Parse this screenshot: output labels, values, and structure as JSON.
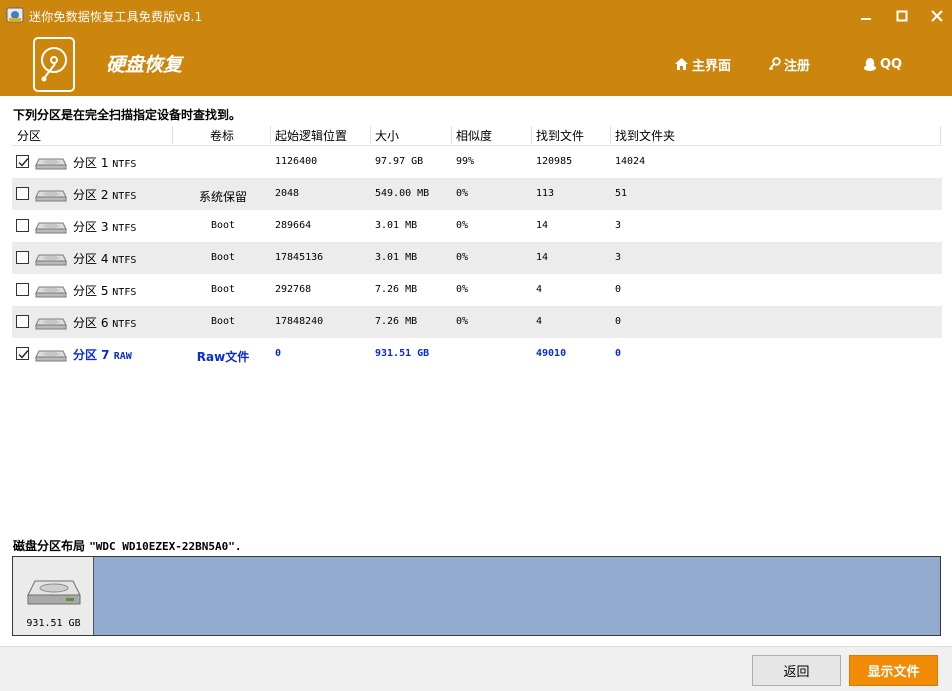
{
  "window": {
    "title": "迷你免数据恢复工具免费版v8.1"
  },
  "header": {
    "title": "硬盘恢复",
    "nav": [
      {
        "label": "主界面",
        "icon": "home-icon"
      },
      {
        "label": "注册",
        "icon": "key-icon"
      },
      {
        "label": "QQ",
        "icon": "qq-penguin-icon"
      }
    ]
  },
  "intro": "下列分区是在完全扫描指定设备时查找到。",
  "table": {
    "columns": [
      "分区",
      "卷标",
      "起始逻辑位置",
      "大小",
      "相似度",
      "找到文件",
      "找到文件夹"
    ],
    "rows": [
      {
        "checked": true,
        "name": "分区 1",
        "fs": "NTFS",
        "label": "",
        "start": "1126400",
        "size": "97.97 GB",
        "similarity": "99%",
        "files": "120985",
        "folders": "14024"
      },
      {
        "checked": false,
        "name": "分区 2",
        "fs": "NTFS",
        "label": "系统保留",
        "start": "2048",
        "size": "549.00 MB",
        "similarity": "0%",
        "files": "113",
        "folders": "51"
      },
      {
        "checked": false,
        "name": "分区 3",
        "fs": "NTFS",
        "label": "Boot",
        "start": "289664",
        "size": "3.01 MB",
        "similarity": "0%",
        "files": "14",
        "folders": "3"
      },
      {
        "checked": false,
        "name": "分区 4",
        "fs": "NTFS",
        "label": "Boot",
        "start": "17845136",
        "size": "3.01 MB",
        "similarity": "0%",
        "files": "14",
        "folders": "3"
      },
      {
        "checked": false,
        "name": "分区 5",
        "fs": "NTFS",
        "label": "Boot",
        "start": "292768",
        "size": "7.26 MB",
        "similarity": "0%",
        "files": "4",
        "folders": "0"
      },
      {
        "checked": false,
        "name": "分区 6",
        "fs": "NTFS",
        "label": "Boot",
        "start": "17848240",
        "size": "7.26 MB",
        "similarity": "0%",
        "files": "4",
        "folders": "0"
      },
      {
        "checked": true,
        "name": "分区 7",
        "fs": "RAW",
        "label": "Raw文件",
        "start": "0",
        "size": "931.51 GB",
        "similarity": "",
        "files": "49010",
        "folders": "0"
      }
    ]
  },
  "layout": {
    "label_prefix": "磁盘分区布局 ",
    "disk_model": "\"WDC WD10EZEX-22BN5A0\".",
    "disk_size": "931.51 GB"
  },
  "buttons": {
    "back": "返回",
    "show_files": "显示文件"
  },
  "colors": {
    "header": "#cc850d",
    "raw_row": "#0b2ccf",
    "layout_bar": "#94abd0",
    "primary_button": "#f28c07"
  }
}
